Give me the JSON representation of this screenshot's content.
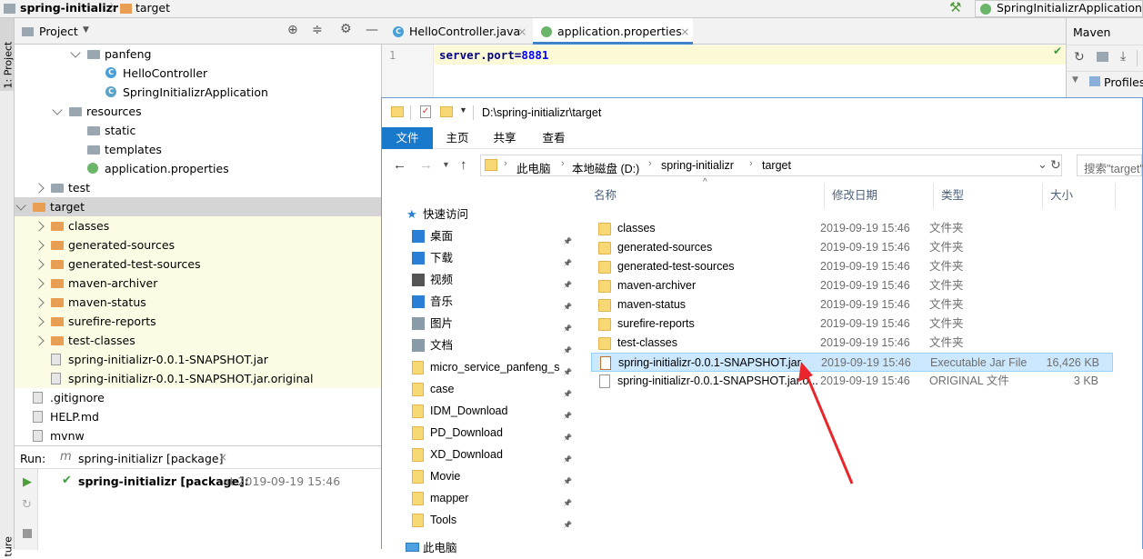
{
  "navbar": {
    "crumb1": "spring-initializr",
    "crumb2": "target",
    "run_config": "SpringInitializrApplication"
  },
  "leftstrip": {
    "project_label": "1: Project",
    "structure_label": "ture"
  },
  "project": {
    "title": "Project",
    "tree": [
      {
        "label": "panfeng",
        "icon": "package-icon",
        "indent": 1,
        "state": "down",
        "bg": "none"
      },
      {
        "label": "HelloController",
        "icon": "class-icon",
        "indent": 2,
        "state": "none",
        "bg": "none"
      },
      {
        "label": "SpringInitializrApplication",
        "icon": "spring-class-icon",
        "indent": 2,
        "state": "none",
        "bg": "none"
      },
      {
        "label": "resources",
        "icon": "resources-folder-icon",
        "indent": 0,
        "state": "down",
        "bg": "none"
      },
      {
        "label": "static",
        "icon": "folder-icon",
        "indent": 1,
        "state": "none",
        "bg": "none"
      },
      {
        "label": "templates",
        "icon": "folder-icon",
        "indent": 1,
        "state": "none",
        "bg": "none"
      },
      {
        "label": "application.properties",
        "icon": "properties-file-icon",
        "indent": 1,
        "state": "none",
        "bg": "none"
      },
      {
        "label": "test",
        "icon": "folder-icon",
        "indent": -1,
        "state": "right",
        "bg": "none"
      },
      {
        "label": "target",
        "icon": "orange-folder-icon",
        "indent": -2,
        "state": "down",
        "bg": "sel"
      },
      {
        "label": "classes",
        "icon": "orange-folder-icon",
        "indent": -1,
        "state": "right",
        "bg": "yel"
      },
      {
        "label": "generated-sources",
        "icon": "orange-folder-icon",
        "indent": -1,
        "state": "right",
        "bg": "yel"
      },
      {
        "label": "generated-test-sources",
        "icon": "orange-folder-icon",
        "indent": -1,
        "state": "right",
        "bg": "yel"
      },
      {
        "label": "maven-archiver",
        "icon": "orange-folder-icon",
        "indent": -1,
        "state": "right",
        "bg": "yel"
      },
      {
        "label": "maven-status",
        "icon": "orange-folder-icon",
        "indent": -1,
        "state": "right",
        "bg": "yel"
      },
      {
        "label": "surefire-reports",
        "icon": "orange-folder-icon",
        "indent": -1,
        "state": "right",
        "bg": "yel"
      },
      {
        "label": "test-classes",
        "icon": "orange-folder-icon",
        "indent": -1,
        "state": "right",
        "bg": "yel"
      },
      {
        "label": "spring-initializr-0.0.1-SNAPSHOT.jar",
        "icon": "jar-file-icon",
        "indent": -1,
        "state": "none",
        "bg": "yel"
      },
      {
        "label": "spring-initializr-0.0.1-SNAPSHOT.jar.original",
        "icon": "original-file-icon",
        "indent": -1,
        "state": "none",
        "bg": "yel"
      },
      {
        "label": ".gitignore",
        "icon": "gitignore-file-icon",
        "indent": -2,
        "state": "none",
        "bg": "none"
      },
      {
        "label": "HELP.md",
        "icon": "markdown-file-icon",
        "indent": -2,
        "state": "none",
        "bg": "none"
      },
      {
        "label": "mvnw",
        "icon": "script-file-icon",
        "indent": -2,
        "state": "none",
        "bg": "none"
      }
    ]
  },
  "run": {
    "label": "Run:",
    "tab": "spring-initializr [package]",
    "result_title": "spring-initializr [package]:",
    "result_time": " at 2019-09-19 15:46"
  },
  "editor": {
    "tab1": "HelloController.java",
    "tab2": "application.properties",
    "line_no": "1",
    "code_key": "server.port",
    "code_eq": "=",
    "code_val": "8881"
  },
  "maven": {
    "title": "Maven",
    "profiles": "Profiles"
  },
  "explorer": {
    "path": "D:\\spring-initializr\\target",
    "ribbon": [
      "文件",
      "主页",
      "共享",
      "查看"
    ],
    "breadcrumb": [
      "此电脑",
      "本地磁盘 (D:)",
      "spring-initializr",
      "target"
    ],
    "search_placeholder": "搜索\"target\"",
    "quick_access": "快速访问",
    "nav_items": [
      {
        "label": "桌面",
        "icon": "desktop-icon"
      },
      {
        "label": "下载",
        "icon": "download-icon"
      },
      {
        "label": "视频",
        "icon": "video-icon"
      },
      {
        "label": "音乐",
        "icon": "music-icon"
      },
      {
        "label": "图片",
        "icon": "picture-icon"
      },
      {
        "label": "文档",
        "icon": "document-icon"
      },
      {
        "label": "micro_service_panfeng_s",
        "icon": "folder-icon"
      },
      {
        "label": "case",
        "icon": "folder-icon"
      },
      {
        "label": "IDM_Download",
        "icon": "folder-icon"
      },
      {
        "label": "PD_Download",
        "icon": "folder-icon"
      },
      {
        "label": "XD_Download",
        "icon": "folder-icon"
      },
      {
        "label": "Movie",
        "icon": "folder-icon"
      },
      {
        "label": "mapper",
        "icon": "folder-icon"
      },
      {
        "label": "Tools",
        "icon": "folder-icon"
      }
    ],
    "this_pc": "此电脑",
    "columns": [
      "名称",
      "修改日期",
      "类型",
      "大小"
    ],
    "files": [
      {
        "name": "classes",
        "date": "2019-09-19 15:46",
        "type": "文件夹",
        "size": "",
        "icon": "folder-icon",
        "selected": false
      },
      {
        "name": "generated-sources",
        "date": "2019-09-19 15:46",
        "type": "文件夹",
        "size": "",
        "icon": "folder-icon",
        "selected": false
      },
      {
        "name": "generated-test-sources",
        "date": "2019-09-19 15:46",
        "type": "文件夹",
        "size": "",
        "icon": "folder-icon",
        "selected": false
      },
      {
        "name": "maven-archiver",
        "date": "2019-09-19 15:46",
        "type": "文件夹",
        "size": "",
        "icon": "folder-icon",
        "selected": false
      },
      {
        "name": "maven-status",
        "date": "2019-09-19 15:46",
        "type": "文件夹",
        "size": "",
        "icon": "folder-icon",
        "selected": false
      },
      {
        "name": "surefire-reports",
        "date": "2019-09-19 15:46",
        "type": "文件夹",
        "size": "",
        "icon": "folder-icon",
        "selected": false
      },
      {
        "name": "test-classes",
        "date": "2019-09-19 15:46",
        "type": "文件夹",
        "size": "",
        "icon": "folder-icon",
        "selected": false
      },
      {
        "name": "spring-initializr-0.0.1-SNAPSHOT.jar",
        "date": "2019-09-19 15:46",
        "type": "Executable Jar File",
        "size": "16,426 KB",
        "icon": "jar-file-icon",
        "selected": true
      },
      {
        "name": "spring-initializr-0.0.1-SNAPSHOT.jar.o...",
        "date": "2019-09-19 15:46",
        "type": "ORIGINAL 文件",
        "size": "3 KB",
        "icon": "file-icon",
        "selected": false
      }
    ]
  },
  "colors": {
    "accent": "#1979ca",
    "selection": "#cce8ff",
    "ide_yellow": "#fcfce5",
    "annotation": "#e8262b"
  }
}
